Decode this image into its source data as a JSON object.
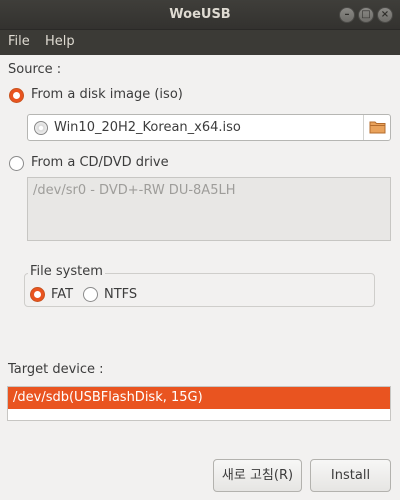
{
  "window": {
    "title": "WoeUSB"
  },
  "menubar": {
    "items": [
      "File",
      "Help"
    ]
  },
  "source": {
    "label": "Source :",
    "disk_image_option": {
      "label": "From a disk image (iso)",
      "selected": true
    },
    "file_path": "Win10_20H2_Korean_x64.iso",
    "cd_option": {
      "label": "From a CD/DVD drive",
      "selected": false
    },
    "drives": [
      "/dev/sr0 - DVD+-RW DU-8A5LH"
    ]
  },
  "filesystem": {
    "label": "File system",
    "options": [
      {
        "label": "FAT",
        "selected": true
      },
      {
        "label": "NTFS",
        "selected": false
      }
    ]
  },
  "target": {
    "label": "Target device :",
    "devices": [
      "/dev/sdb(USBFlashDisk,  15G)"
    ],
    "selected_index": 0
  },
  "buttons": {
    "refresh": "새로 고침(R)",
    "install": "Install"
  },
  "colors": {
    "accent": "#e95420",
    "titlebar": "#3b3a36"
  },
  "icons": [
    "minimize-icon",
    "maximize-icon",
    "close-icon",
    "disc-icon",
    "folder-icon"
  ]
}
